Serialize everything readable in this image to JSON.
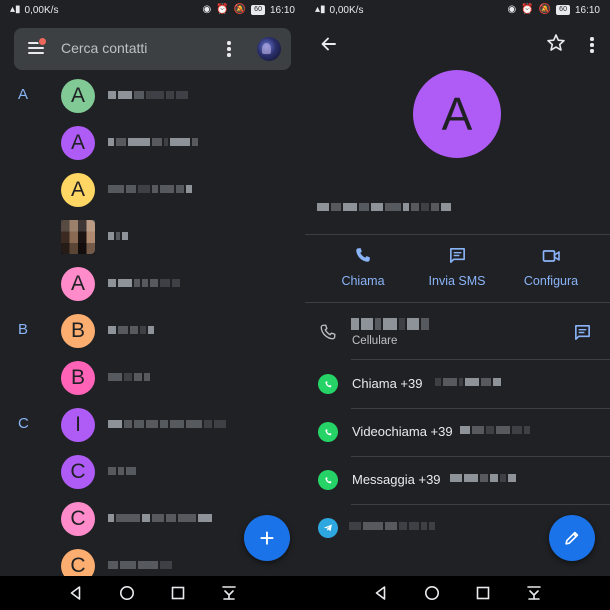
{
  "status_bar": {
    "network_speed": "0,00K/s",
    "battery": "60",
    "time": "16:10"
  },
  "contacts_screen": {
    "search_placeholder": "Cerca contatti",
    "sections": [
      "A",
      "B",
      "C"
    ],
    "contacts": [
      {
        "section": "A",
        "initial": "A",
        "color": "#81c995"
      },
      {
        "section": "",
        "initial": "A",
        "color": "#af5cf7"
      },
      {
        "section": "",
        "initial": "A",
        "color": "#fdd663"
      },
      {
        "section": "",
        "initial": "",
        "color": "photo"
      },
      {
        "section": "",
        "initial": "A",
        "color": "#ff8bcb"
      },
      {
        "section": "B",
        "initial": "B",
        "color": "#fcad70"
      },
      {
        "section": "",
        "initial": "B",
        "color": "#ff63b8"
      },
      {
        "section": "C",
        "initial": "I",
        "color": "#af5cf7"
      },
      {
        "section": "",
        "initial": "C",
        "color": "#af5cf7"
      },
      {
        "section": "",
        "initial": "C",
        "color": "#ff8bcb"
      },
      {
        "section": "",
        "initial": "C",
        "color": "#fcad70"
      }
    ],
    "fab_label": "+"
  },
  "detail_screen": {
    "avatar_initial": "A",
    "avatar_color": "#af5cf7",
    "actions": [
      {
        "label": "Chiama",
        "icon": "phone-icon"
      },
      {
        "label": "Invia SMS",
        "icon": "message-icon"
      },
      {
        "label": "Configura",
        "icon": "videocam-icon"
      }
    ],
    "phone_type": "Cellulare",
    "app_rows": [
      {
        "app": "whatsapp",
        "label": "Chiama +39"
      },
      {
        "app": "whatsapp",
        "label": "Videochiama +39"
      },
      {
        "app": "whatsapp",
        "label": "Messaggia +39"
      },
      {
        "app": "telegram",
        "label": ""
      }
    ]
  },
  "colors": {
    "background": "#202124",
    "accent": "#8ab4f8",
    "fab": "#1a73e8"
  }
}
